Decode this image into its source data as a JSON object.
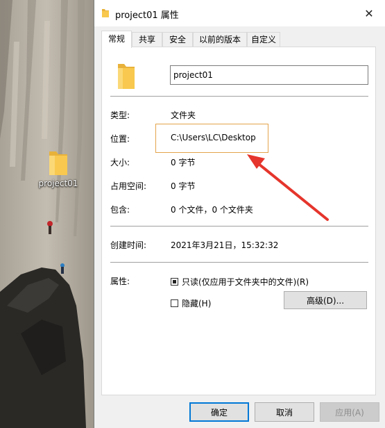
{
  "desktop": {
    "icon_label": "project01"
  },
  "window": {
    "title": "project01 属性",
    "close_glyph": "✕"
  },
  "tabs": [
    {
      "label": "常规",
      "active": true
    },
    {
      "label": "共享",
      "active": false
    },
    {
      "label": "安全",
      "active": false
    },
    {
      "label": "以前的版本",
      "active": false
    },
    {
      "label": "自定义",
      "active": false
    }
  ],
  "general": {
    "name_value": "project01",
    "rows": [
      {
        "label": "类型:",
        "value": "文件夹"
      },
      {
        "label": "位置:",
        "value": "C:\\Users\\LC\\Desktop"
      },
      {
        "label": "大小:",
        "value": "0 字节"
      },
      {
        "label": "占用空间:",
        "value": "0 字节"
      },
      {
        "label": "包含:",
        "value": "0 个文件，0 个文件夹"
      },
      {
        "label": "创建时间:",
        "value": "2021年3月21日，15:32:32"
      }
    ],
    "attributes_label": "属性:",
    "readonly_label": "只读(仅应用于文件夹中的文件)(R)",
    "readonly_checked": true,
    "hidden_label": "隐藏(H)",
    "hidden_checked": false,
    "advanced_label": "高级(D)..."
  },
  "buttons": {
    "ok": "确定",
    "cancel": "取消",
    "apply": "应用(A)"
  },
  "colors": {
    "highlight_border": "#e3a24a",
    "arrow": "#e5352c",
    "folder": "#f8c94e",
    "default_button_border": "#0078d7"
  }
}
